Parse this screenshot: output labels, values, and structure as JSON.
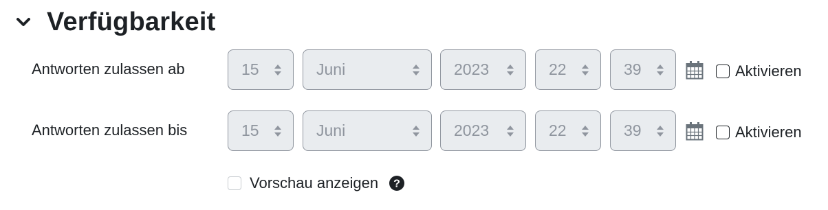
{
  "section": {
    "title": "Verfügbarkeit",
    "collapse_icon": "chevron-down-icon"
  },
  "rows": [
    {
      "label": "Antworten zulassen ab",
      "day": "15",
      "month": "Juni",
      "year": "2023",
      "hour": "22",
      "minute": "39",
      "enable_label": "Aktivieren",
      "enabled": false
    },
    {
      "label": "Antworten zulassen bis",
      "day": "15",
      "month": "Juni",
      "year": "2023",
      "hour": "22",
      "minute": "39",
      "enable_label": "Aktivieren",
      "enabled": false
    }
  ],
  "preview": {
    "label": "Vorschau anzeigen",
    "checked": false,
    "disabled": true,
    "help_icon": "question-circle-icon"
  },
  "colors": {
    "text": "#1d2125",
    "disabled_text": "#8f959e",
    "disabled_bg": "#e9ecef"
  }
}
